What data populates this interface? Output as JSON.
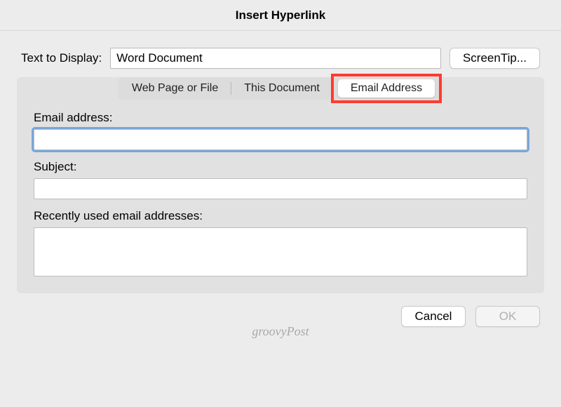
{
  "dialog": {
    "title": "Insert Hyperlink"
  },
  "topRow": {
    "displayLabel": "Text to Display:",
    "displayValue": "Word Document",
    "screenTipLabel": "ScreenTip..."
  },
  "tabs": {
    "web": "Web Page or File",
    "doc": "This Document",
    "email": "Email Address",
    "active": "email"
  },
  "emailPanel": {
    "emailLabel": "Email address:",
    "emailValue": "",
    "subjectLabel": "Subject:",
    "subjectValue": "",
    "recentLabel": "Recently used email addresses:"
  },
  "footer": {
    "cancel": "Cancel",
    "ok": "OK"
  },
  "watermark": "groovyPost"
}
